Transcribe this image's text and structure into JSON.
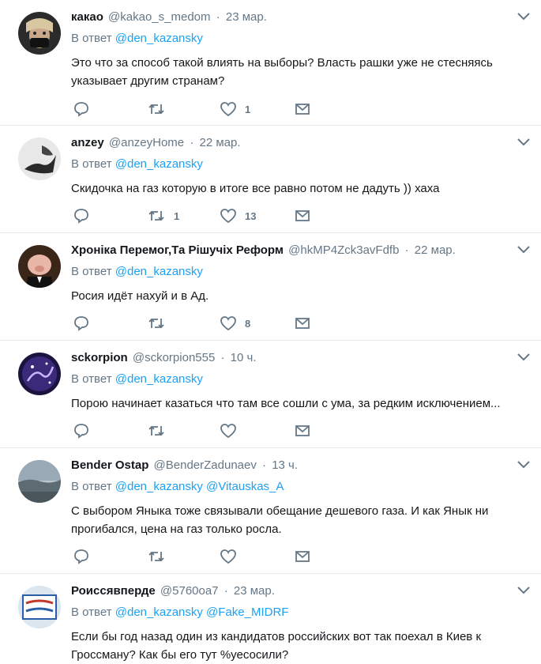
{
  "labels": {
    "in_reply": "В ответ"
  },
  "colors": {
    "link": "#1da1f2",
    "muted": "#657786",
    "text": "#14171a",
    "divider": "#e6ecf0"
  },
  "tweets": [
    {
      "name": "какао",
      "handle": "@kakao_s_medom",
      "time": "23 мар.",
      "mentions": [
        "@den_kazansky"
      ],
      "text": "Это что за способ такой влиять на выборы? Власть рашки уже не стесняясь указывает другим странам?",
      "retweets": "",
      "likes": "1"
    },
    {
      "name": "anzey",
      "handle": "@anzeyHome",
      "time": "22 мар.",
      "mentions": [
        "@den_kazansky"
      ],
      "text": "Скидочка на газ которую в итоге все равно потом не дадуть )) хаха",
      "retweets": "1",
      "likes": "13"
    },
    {
      "name": "Хроніка Перемог,Та Рішучіх Реформ",
      "handle": "@hkMP4Zck3avFdfb",
      "time": "22 мар.",
      "mentions": [
        "@den_kazansky"
      ],
      "text": "Росия идёт нахуй и в Ад.",
      "retweets": "",
      "likes": "8"
    },
    {
      "name": "sckorpion",
      "handle": "@sckorpion555",
      "time": "10 ч.",
      "mentions": [
        "@den_kazansky"
      ],
      "text": "Порою начинает казаться что там все сошли с ума, за редким исключением...",
      "retweets": "",
      "likes": ""
    },
    {
      "name": "Bender Ostap",
      "handle": "@BenderZadunaev",
      "time": "13 ч.",
      "mentions": [
        "@den_kazansky",
        "@Vitauskas_A"
      ],
      "text": "С выбором Яныка тоже связывали обещание дешевого газа. И как Янык ни прогибался, цена на газ только росла.",
      "retweets": "",
      "likes": ""
    },
    {
      "name": "Роиссявперде",
      "handle": "@5760oa7",
      "time": "23 мар.",
      "mentions": [
        "@den_kazansky",
        "@Fake_MIDRF"
      ],
      "text": "Если бы год назад один из кандидатов российских вот так поехал в Киев к Гроссману? Как бы его тут %уесосили?",
      "retweets": "",
      "likes": ""
    }
  ]
}
